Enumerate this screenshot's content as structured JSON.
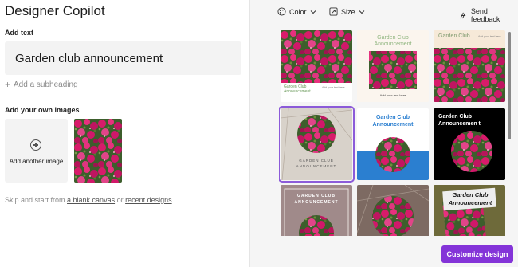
{
  "app": {
    "title": "Designer Copilot"
  },
  "add_text": {
    "label": "Add text",
    "value": "Garden club announcement",
    "add_subheading": "Add a subheading"
  },
  "images": {
    "label": "Add your own images",
    "add_button_label": "Add another image"
  },
  "skip": {
    "prefix": "Skip and start from ",
    "blank_canvas": "a blank canvas",
    "middle": " or ",
    "recent_designs": "recent designs"
  },
  "toolbar": {
    "color_label": "Color",
    "size_label": "Size",
    "feedback_label": "Send feedback"
  },
  "designs": [
    {
      "id": 1,
      "caption_line1": "Garden Club",
      "caption_line2": "Announcement",
      "extra": "Add your text here"
    },
    {
      "id": 2,
      "title": "Garden Club Announcement",
      "subtitle": "Add your text here"
    },
    {
      "id": 3,
      "title": "Garden Club",
      "subtitle": "Add your text here"
    },
    {
      "id": 4,
      "title": "GARDEN CLUB ANNOUNCEMENT"
    },
    {
      "id": 5,
      "title": "Garden Club Announcement"
    },
    {
      "id": 6,
      "title": "Garden Club Announcemen t"
    },
    {
      "id": 7,
      "title": "GARDEN CLUB ANNOUNCEMENT"
    },
    {
      "id": 8,
      "title": ""
    },
    {
      "id": 9,
      "title": "Garden Club Announcement"
    }
  ],
  "cta": {
    "label": "Customize design"
  },
  "colors": {
    "accent": "#8434d8",
    "selection": "#8c5bd9",
    "flower": "#d6206d",
    "foliage": "#2f5a2a"
  }
}
